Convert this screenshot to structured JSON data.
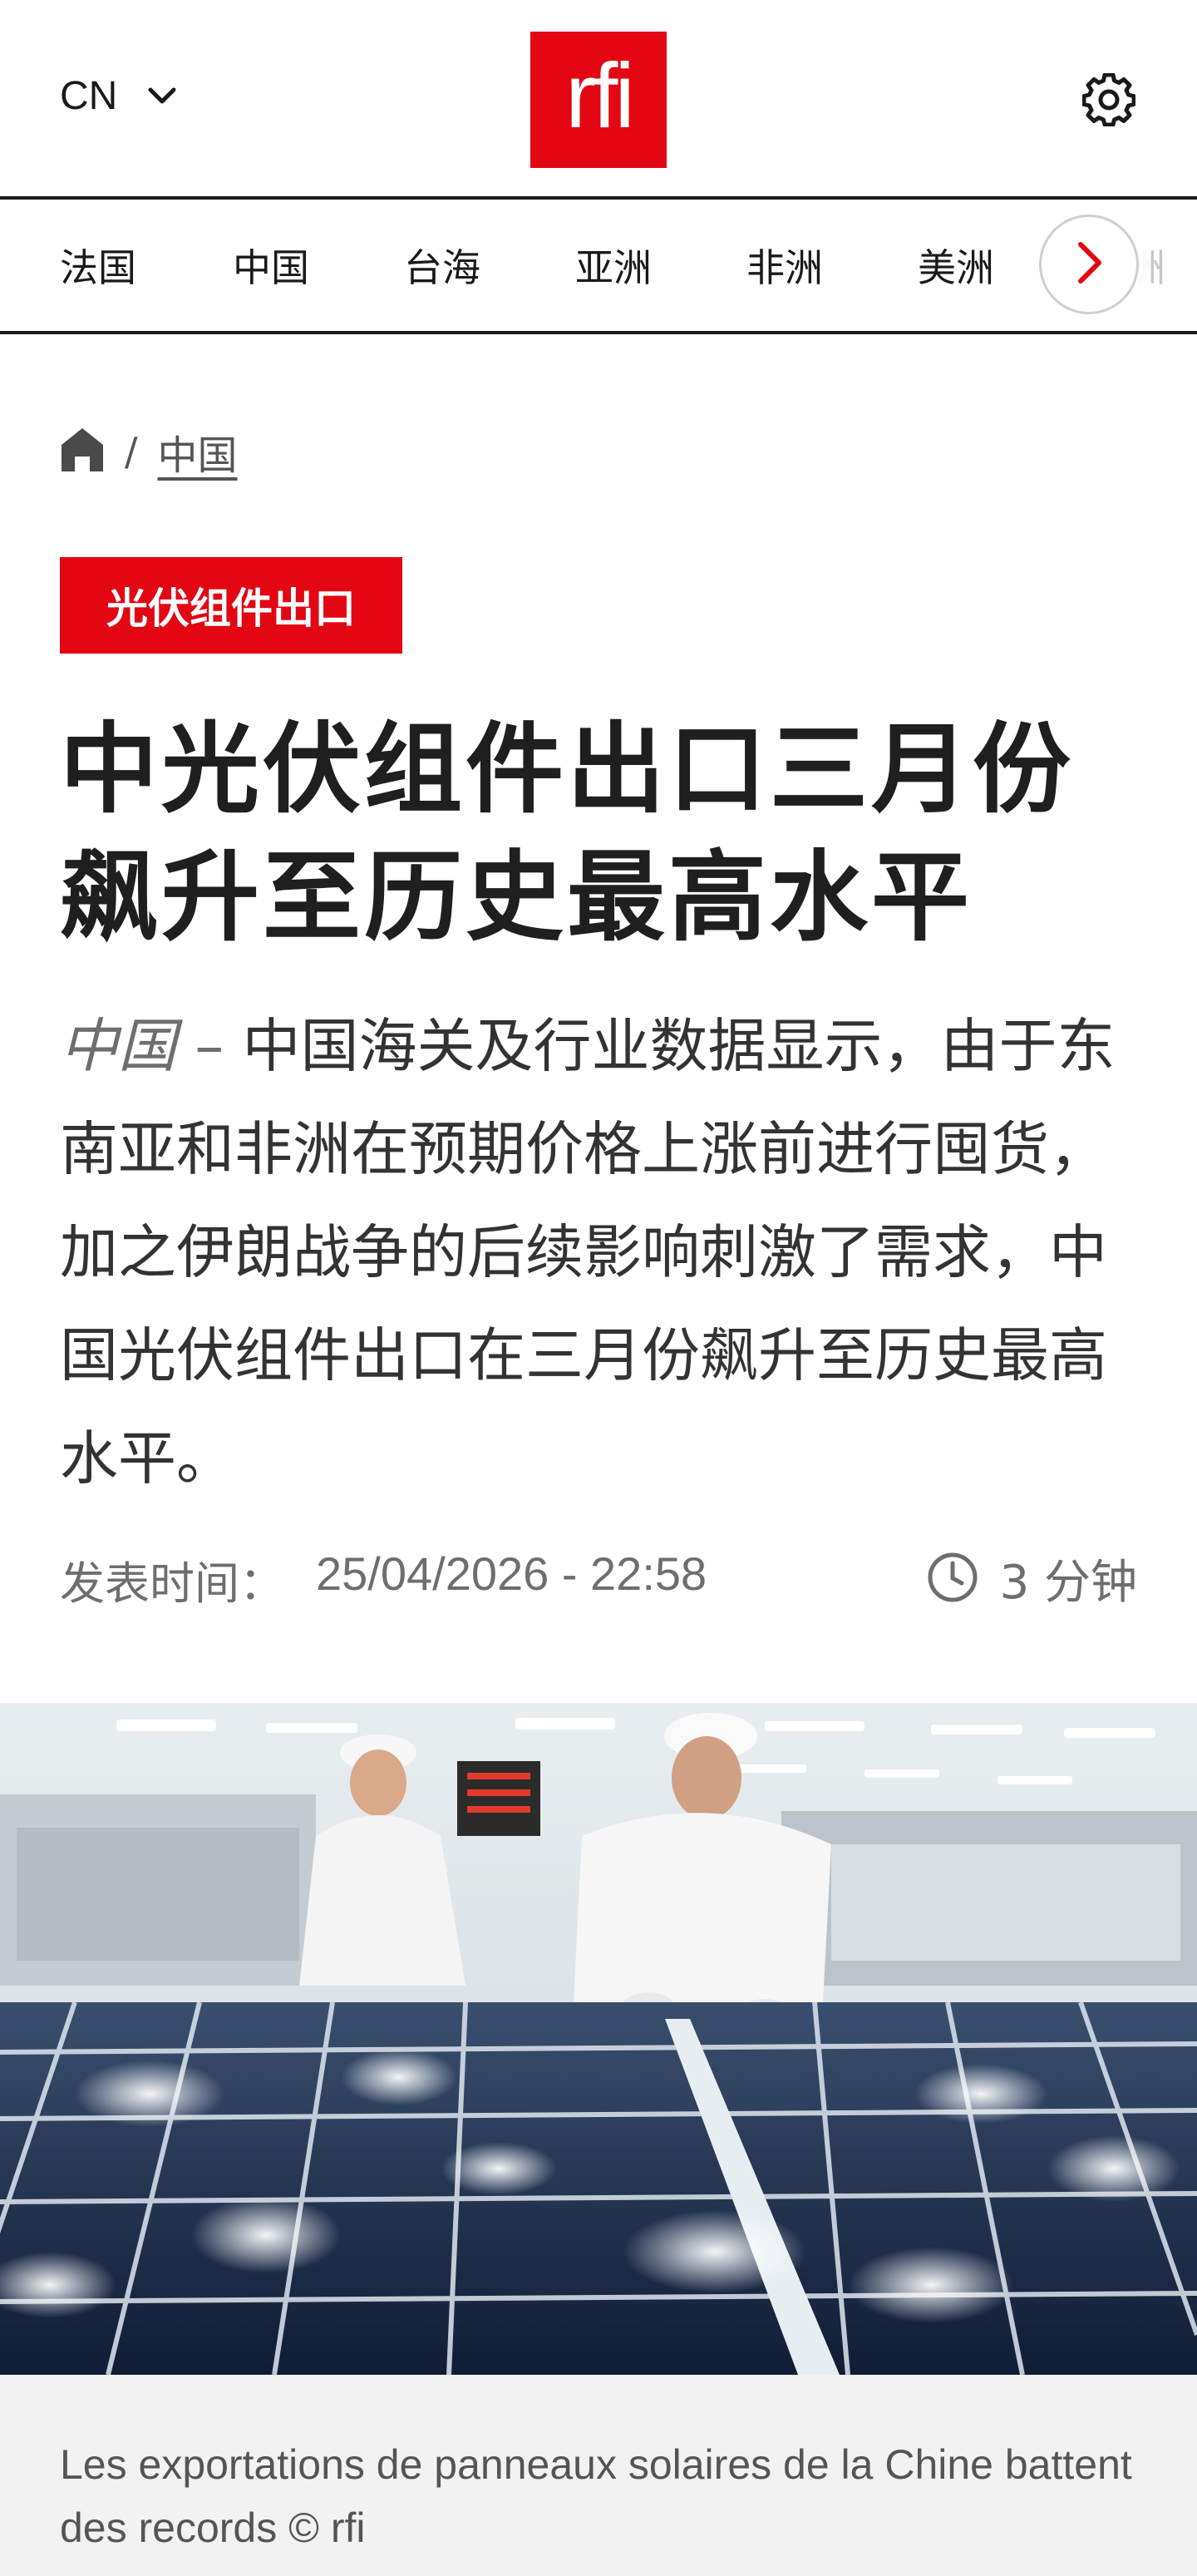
{
  "header": {
    "lang_label": "CN",
    "logo_text": "rfi",
    "icons": {
      "chevron": "chevron-down-icon",
      "settings": "gear-icon"
    }
  },
  "nav": {
    "items": [
      {
        "label": "法国"
      },
      {
        "label": "中国"
      },
      {
        "label": "台海"
      },
      {
        "label": "亚洲"
      },
      {
        "label": "非洲"
      },
      {
        "label": "美洲"
      },
      {
        "label": "洲"
      }
    ],
    "next_icon": "chevron-right-icon"
  },
  "breadcrumb": {
    "home_icon": "home-icon",
    "separator": "/",
    "section": "中国"
  },
  "article": {
    "tag": "光伏组件出口",
    "title": "中光伏组件出口三月份飙升至历史最高水平",
    "lead_location": "中国",
    "lead_dash": "–",
    "lead_text": "中国海关及行业数据显示，由于东南亚和非洲在预期价格上涨前进行囤货，加之伊朗战争的后续影响刺激了需求，中国光伏组件出口在三月份飙升至历史最高水平。",
    "published_label": "发表时间：",
    "published_date": "25/04/2026 - 22:58",
    "read_time_icon": "clock-icon",
    "read_time": "3 分钟"
  },
  "photo": {
    "caption": "Les exportations de panneaux solaires de la Chine battent des records © rfi"
  },
  "colors": {
    "brand_red": "#e30613",
    "text_dark": "#1f1f1f",
    "text_muted": "#6e6e6e",
    "caption_bg": "#f2f2f2"
  }
}
